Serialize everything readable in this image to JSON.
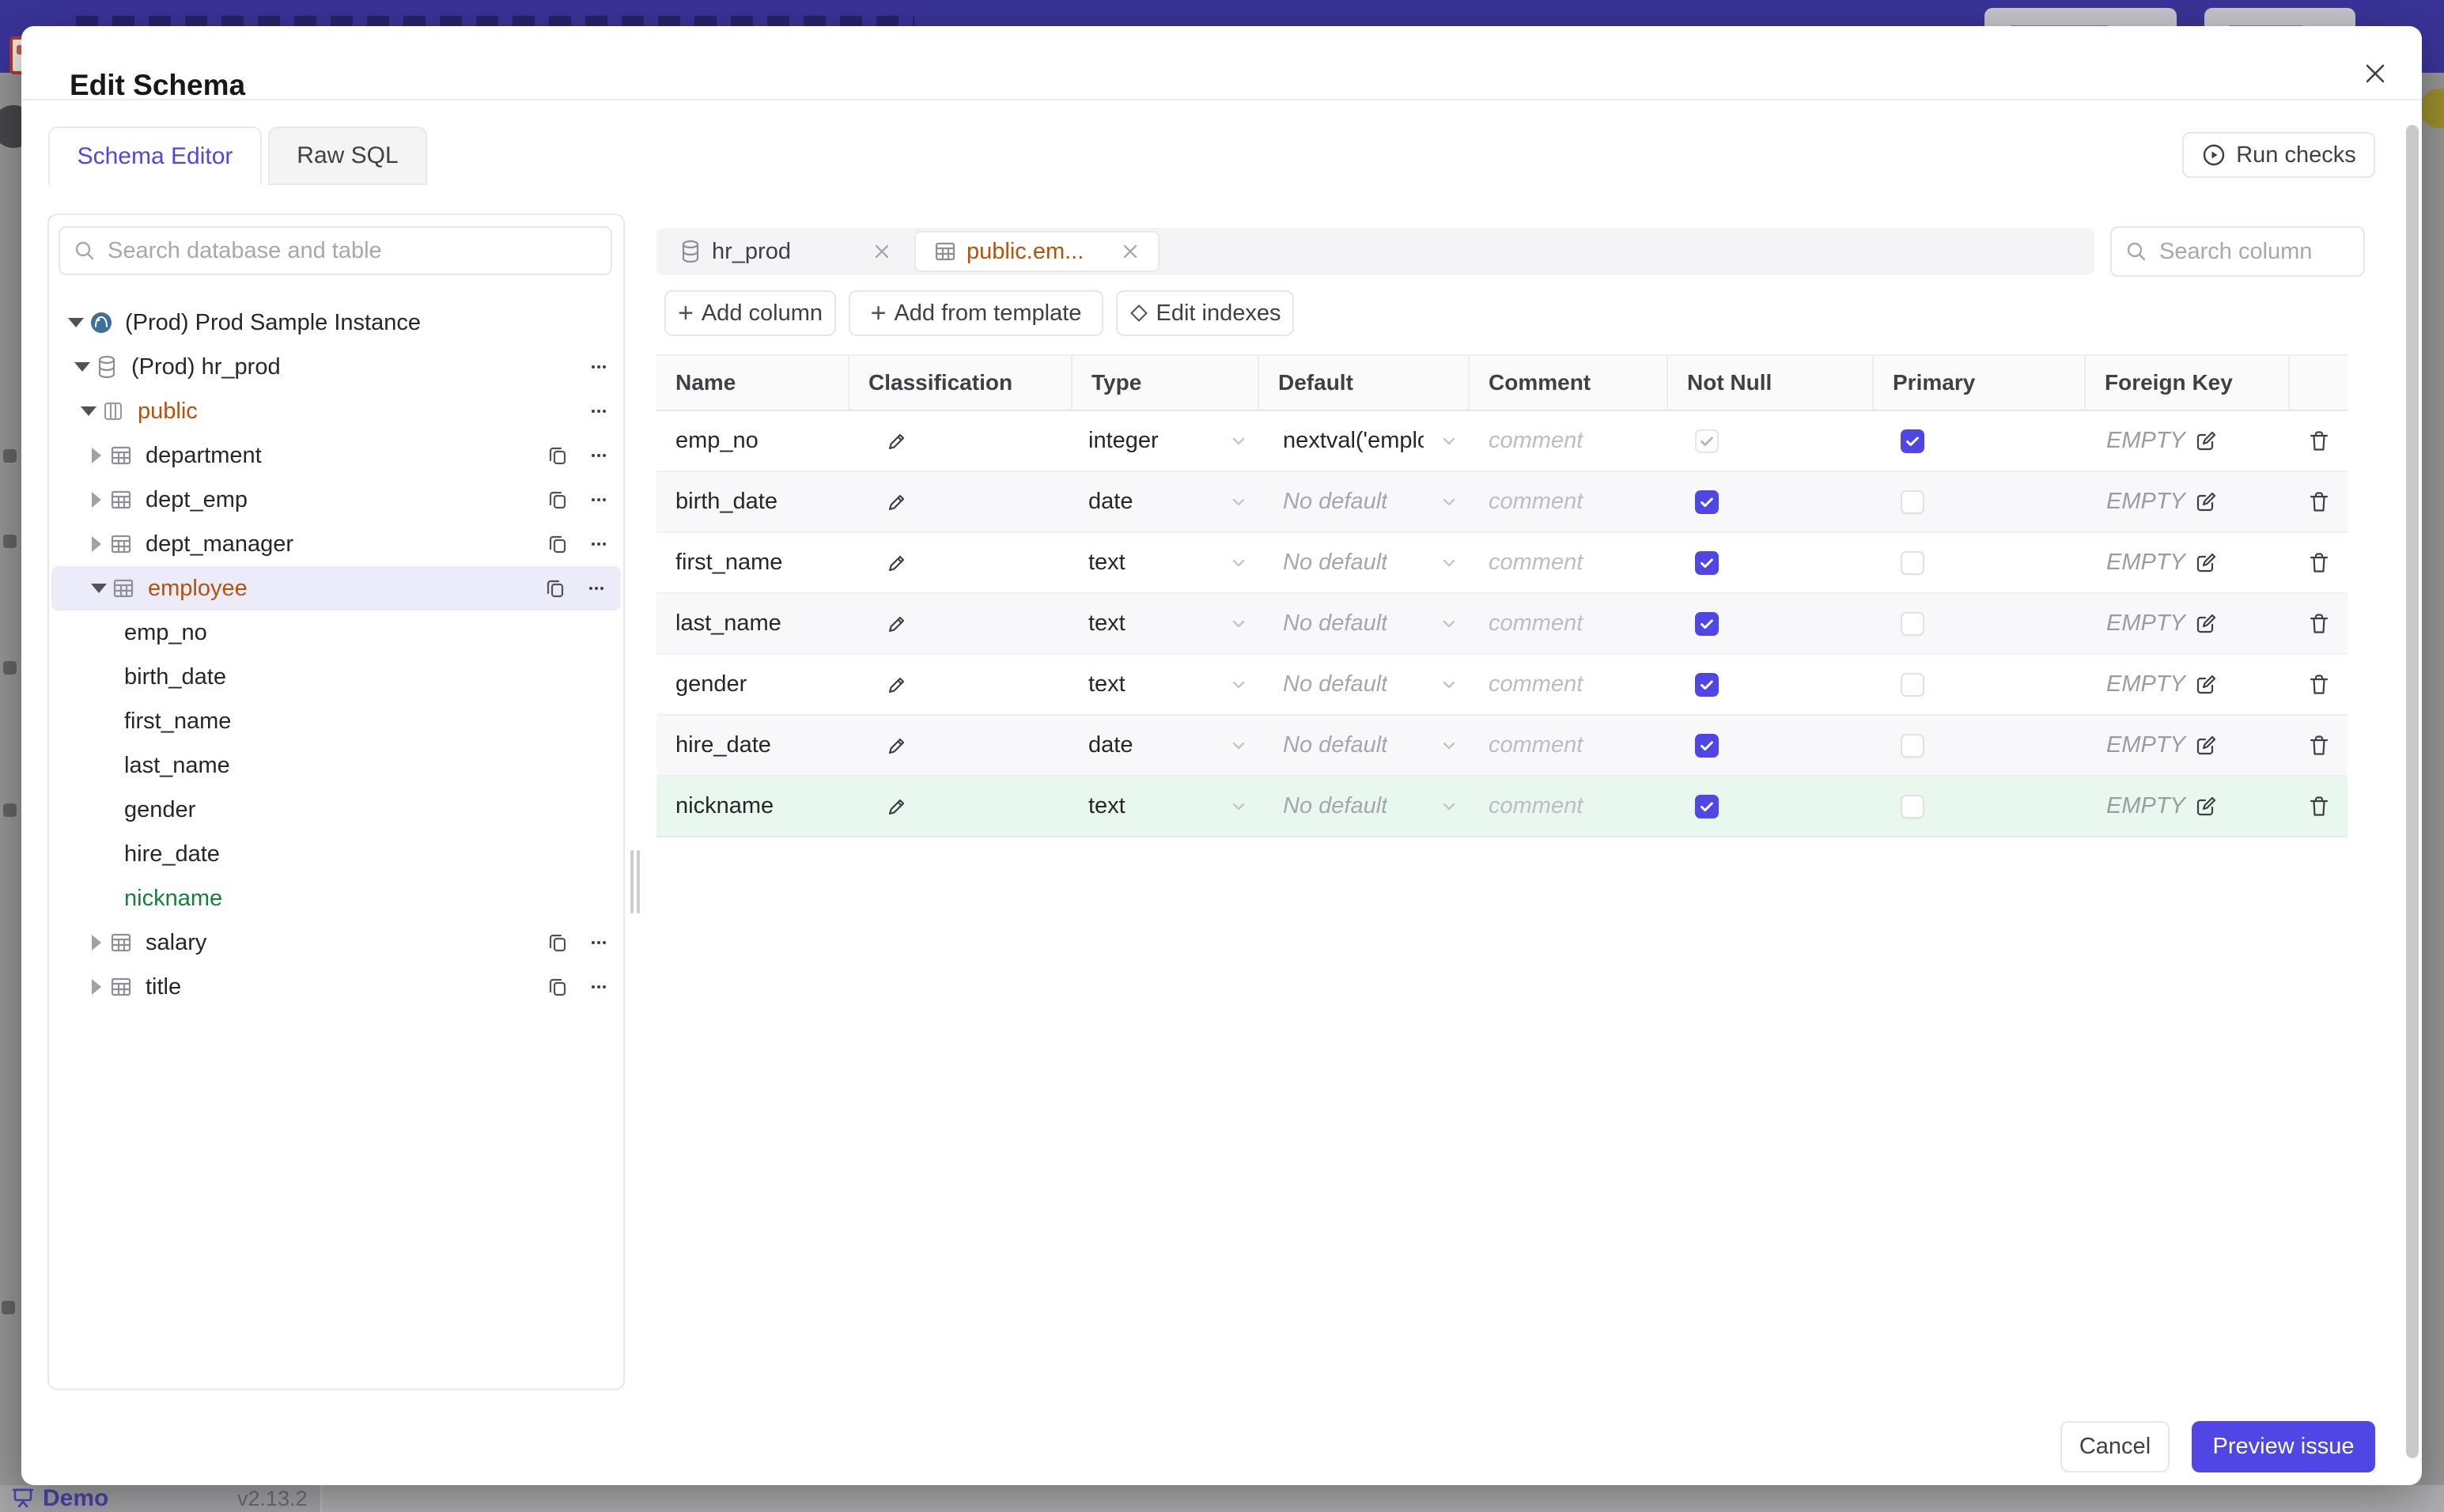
{
  "page": {
    "banner_color": "#3a3499",
    "overlay_color": "#969696",
    "status_bar": {
      "demo_label": "Demo",
      "version": "v2.13.2"
    }
  },
  "modal": {
    "title": "Edit Schema",
    "close_icon": "close-icon",
    "tabs": [
      {
        "label": "Schema Editor",
        "active": true
      },
      {
        "label": "Raw SQL",
        "active": false
      }
    ],
    "run_checks_label": "Run checks",
    "sidebar": {
      "search_placeholder": "Search database and table",
      "tree": [
        {
          "label": "(Prod) Prod Sample Instance",
          "level": 0,
          "icon": "postgres-icon",
          "state": "expanded",
          "actions": []
        },
        {
          "label": "(Prod) hr_prod",
          "level": 1,
          "icon": "database-icon",
          "state": "expanded",
          "actions": [
            "more"
          ]
        },
        {
          "label": "public",
          "level": 2,
          "icon": "schema-icon",
          "state": "expanded",
          "color": "amber",
          "actions": [
            "more"
          ]
        },
        {
          "label": "department",
          "level": 3,
          "icon": "table-icon",
          "state": "collapsed",
          "actions": [
            "copy",
            "more"
          ]
        },
        {
          "label": "dept_emp",
          "level": 3,
          "icon": "table-icon",
          "state": "collapsed",
          "actions": [
            "copy",
            "more"
          ]
        },
        {
          "label": "dept_manager",
          "level": 3,
          "icon": "table-icon",
          "state": "collapsed",
          "actions": [
            "copy",
            "more"
          ]
        },
        {
          "label": "employee",
          "level": 3,
          "icon": "table-icon",
          "state": "expanded",
          "color": "amber",
          "selected": true,
          "actions": [
            "copy",
            "more"
          ]
        },
        {
          "label": "emp_no",
          "level": 4,
          "actions": []
        },
        {
          "label": "birth_date",
          "level": 4,
          "actions": []
        },
        {
          "label": "first_name",
          "level": 4,
          "actions": []
        },
        {
          "label": "last_name",
          "level": 4,
          "actions": []
        },
        {
          "label": "gender",
          "level": 4,
          "actions": []
        },
        {
          "label": "hire_date",
          "level": 4,
          "actions": []
        },
        {
          "label": "nickname",
          "level": 4,
          "color": "green",
          "actions": []
        },
        {
          "label": "salary",
          "level": 3,
          "icon": "table-icon",
          "state": "collapsed",
          "actions": [
            "copy",
            "more"
          ]
        },
        {
          "label": "title",
          "level": 3,
          "icon": "table-icon",
          "state": "collapsed",
          "actions": [
            "copy",
            "more"
          ]
        }
      ]
    },
    "editor": {
      "open_tabs": [
        {
          "label": "hr_prod",
          "icon": "database-icon",
          "active": false
        },
        {
          "label": "public.em...",
          "icon": "table-icon",
          "active": true,
          "color": "amber"
        }
      ],
      "column_search_placeholder": "Search column",
      "toolbar": [
        {
          "label": "Add column",
          "icon": "plus-icon"
        },
        {
          "label": "Add from template",
          "icon": "plus-icon"
        },
        {
          "label": "Edit indexes",
          "icon": "diamond-icon"
        }
      ],
      "table": {
        "headers": [
          "Name",
          "Classification",
          "Type",
          "Default",
          "Comment",
          "Not Null",
          "Primary",
          "Foreign Key",
          ""
        ],
        "comment_placeholder": "comment",
        "foreign_key_value": "EMPTY",
        "rows": [
          {
            "name": "emp_no",
            "type": "integer",
            "default": "nextval('employ",
            "default_is_placeholder": false,
            "not_null": "checked_disabled",
            "primary": true,
            "highlight": null
          },
          {
            "name": "birth_date",
            "type": "date",
            "default": "No default",
            "default_is_placeholder": true,
            "not_null": "checked",
            "primary": false,
            "highlight": null
          },
          {
            "name": "first_name",
            "type": "text",
            "default": "No default",
            "default_is_placeholder": true,
            "not_null": "checked",
            "primary": false,
            "highlight": null
          },
          {
            "name": "last_name",
            "type": "text",
            "default": "No default",
            "default_is_placeholder": true,
            "not_null": "checked",
            "primary": false,
            "highlight": null
          },
          {
            "name": "gender",
            "type": "text",
            "default": "No default",
            "default_is_placeholder": true,
            "not_null": "checked",
            "primary": false,
            "highlight": null
          },
          {
            "name": "hire_date",
            "type": "date",
            "default": "No default",
            "default_is_placeholder": true,
            "not_null": "checked",
            "primary": false,
            "highlight": null
          },
          {
            "name": "nickname",
            "type": "text",
            "default": "No default",
            "default_is_placeholder": true,
            "not_null": "checked",
            "primary": false,
            "highlight": "new"
          }
        ]
      }
    },
    "footer": {
      "cancel_label": "Cancel",
      "submit_label": "Preview issue"
    }
  },
  "colors": {
    "accent": "#4f46e5",
    "modified_amber": "#b45309",
    "new_green": "#15803d",
    "new_row_bg": "#e9f8ef",
    "selected_tree_bg": "#ecebfa"
  }
}
